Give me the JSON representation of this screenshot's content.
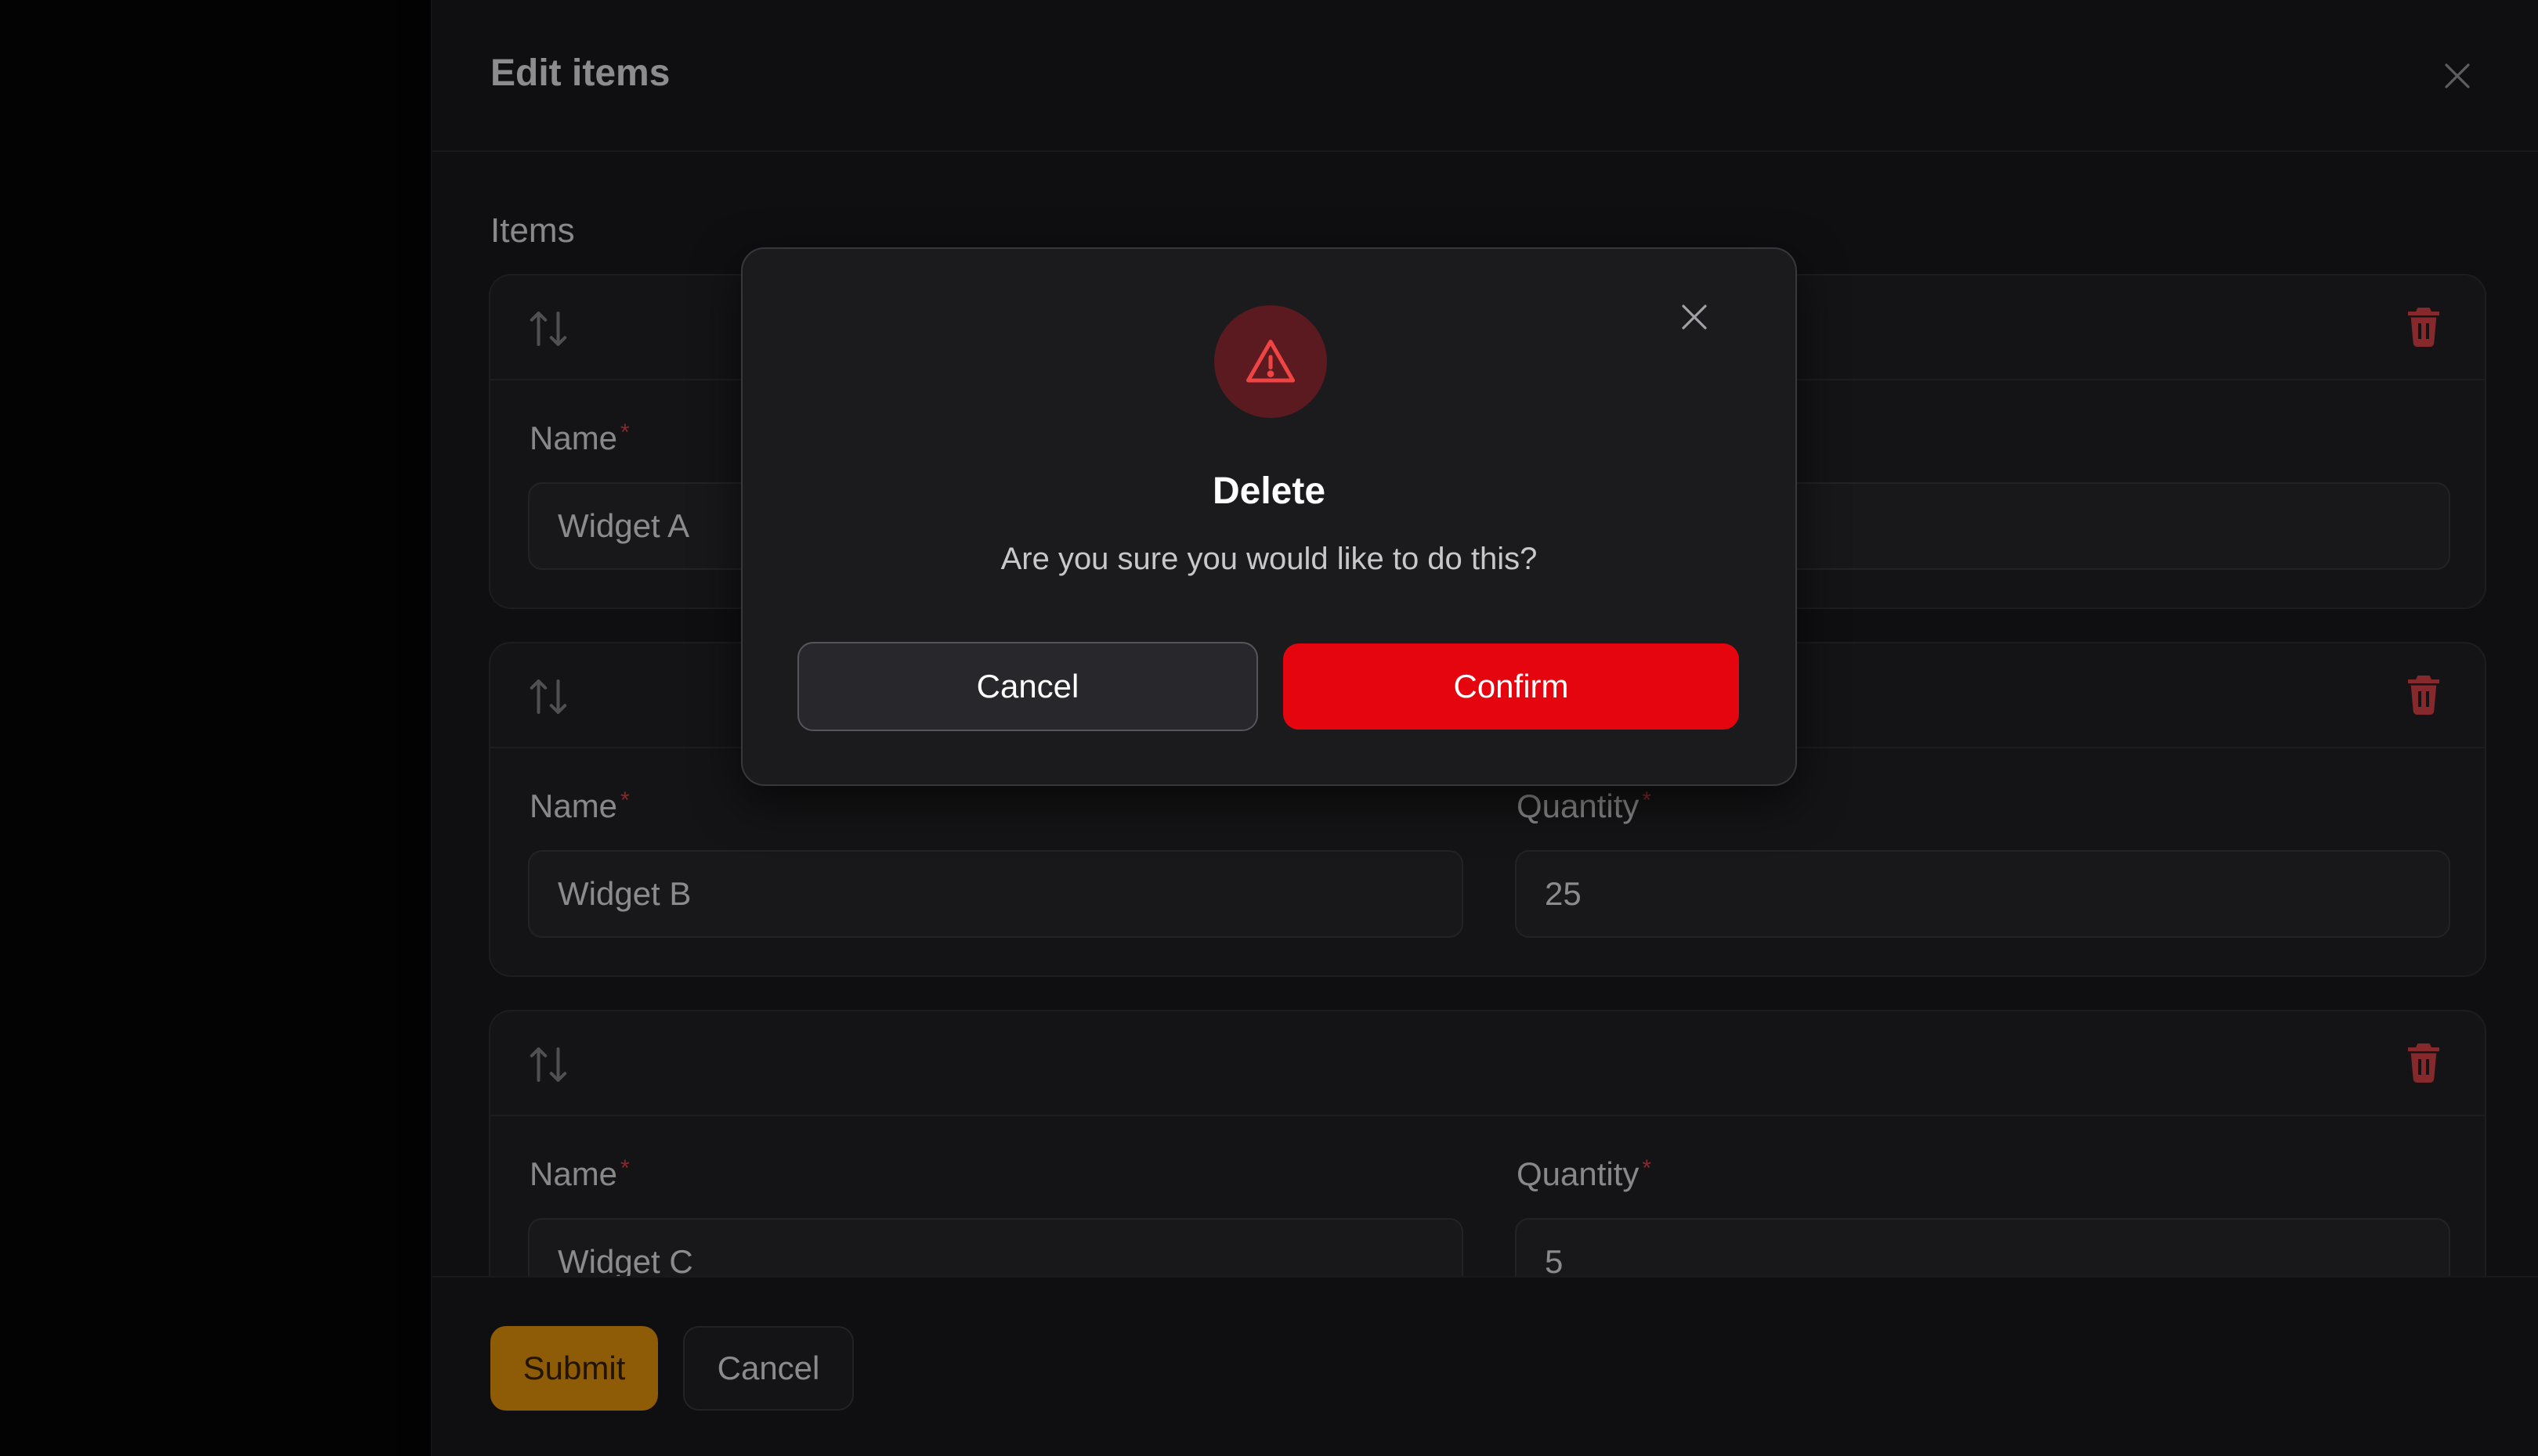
{
  "panel": {
    "title": "Edit items",
    "section_label": "Items"
  },
  "items": [
    {
      "name_label": "Name",
      "name_value": "Widget A",
      "quantity_label": "Quantity",
      "quantity_value": ""
    },
    {
      "name_label": "Name",
      "name_value": "Widget B",
      "quantity_label": "Quantity",
      "quantity_value": "25"
    },
    {
      "name_label": "Name",
      "name_value": "Widget C",
      "quantity_label": "Quantity",
      "quantity_value": "5"
    }
  ],
  "required_mark": "*",
  "footer": {
    "submit_label": "Submit",
    "cancel_label": "Cancel"
  },
  "modal": {
    "title": "Delete",
    "message": "Are you sure you would like to do this?",
    "cancel_label": "Cancel",
    "confirm_label": "Confirm"
  },
  "icons": {
    "close": "close-icon",
    "reorder": "arrows-up-down-icon",
    "delete": "trash-icon",
    "warning": "warning-triangle-icon"
  },
  "colors": {
    "accent_primary": "#f59e0b",
    "danger": "#e5050f",
    "trash": "#e5484d"
  }
}
